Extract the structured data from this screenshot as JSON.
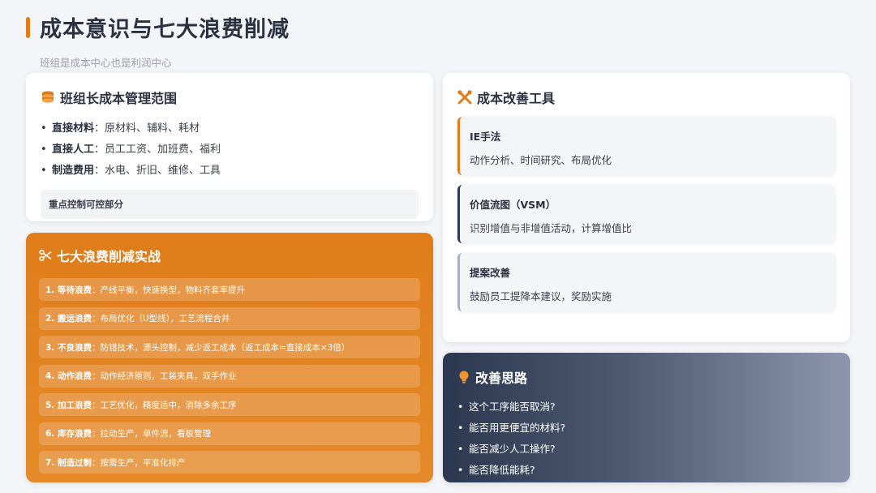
{
  "header": {
    "title": "成本意识与七大浪费削减",
    "subtitle": "班组是成本中心也是利润中心"
  },
  "colors": {
    "accent": "#e07c1a",
    "navy": "#2c3850",
    "grey": "#a9b0be"
  },
  "scope_card": {
    "icon": "coins-icon",
    "title": "班组长成本管理范围",
    "items": [
      {
        "key": "直接材料",
        "value": "：原材料、辅料、耗材"
      },
      {
        "key": "直接人工",
        "value": "：员工工资、加班费、福利"
      },
      {
        "key": "制造费用",
        "value": "：水电、折旧、维修、工具"
      }
    ],
    "note": "重点控制可控部分"
  },
  "waste_card": {
    "icon": "scissors-icon",
    "title": "七大浪费削减实战",
    "items": [
      {
        "key": "1. 等待浪费",
        "value": "：产线平衡，快速换型，物料齐套率提升"
      },
      {
        "key": "2. 搬运浪费",
        "value": "：布局优化（U型线），工艺流程合并"
      },
      {
        "key": "3. 不良浪费",
        "value": "：防错技术，源头控制，减少返工成本（返工成本=直接成本×3倍）"
      },
      {
        "key": "4. 动作浪费",
        "value": "：动作经济原则，工装夹具，双手作业"
      },
      {
        "key": "5. 加工浪费",
        "value": "：工艺优化，精度适中，消除多余工序"
      },
      {
        "key": "6. 库存浪费",
        "value": "：拉动生产，单件流，看板管理"
      },
      {
        "key": "7. 制造过剩",
        "value": "：按需生产，平准化排产"
      }
    ]
  },
  "tools_card": {
    "icon": "tools-icon",
    "title": "成本改善工具",
    "tools": [
      {
        "title": "IE手法",
        "desc": "动作分析、时间研究、布局优化"
      },
      {
        "title": "价值流图（VSM）",
        "desc": "识别增值与非增值活动，计算增值比"
      },
      {
        "title": "提案改善",
        "desc": "鼓励员工提降本建议，奖励实施"
      }
    ]
  },
  "ideas_card": {
    "icon": "lightbulb-icon",
    "title": "改善思路",
    "items": [
      "这个工序能否取消?",
      "能否用更便宜的材料?",
      "能否减少人工操作?",
      "能否降低能耗?"
    ]
  }
}
